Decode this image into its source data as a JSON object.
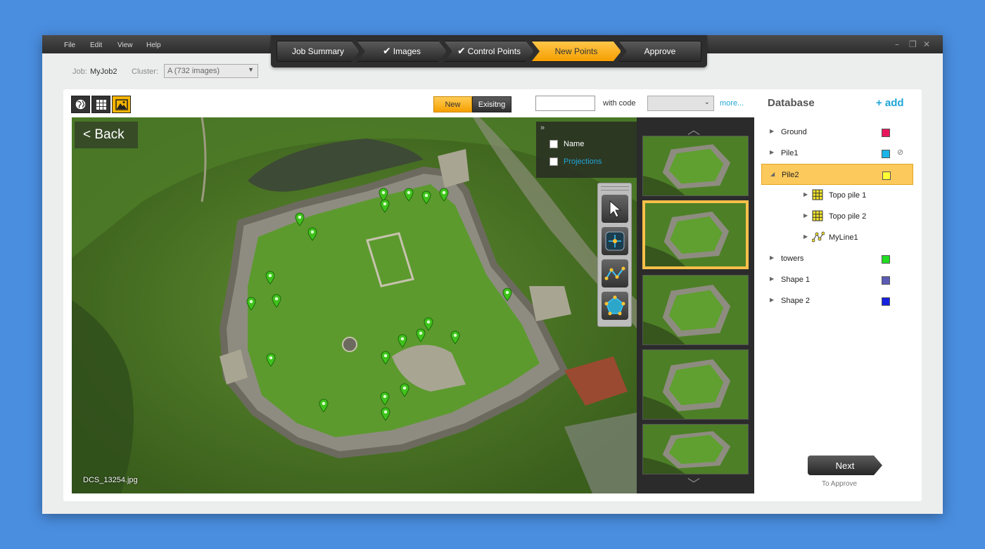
{
  "menu": [
    "File",
    "Edit",
    "View",
    "Help"
  ],
  "window_controls": [
    "–",
    "❐",
    "✕"
  ],
  "steps": [
    {
      "label": "Job Summary",
      "checked": false
    },
    {
      "label": "Images",
      "checked": true
    },
    {
      "label": "Control Points",
      "checked": true
    },
    {
      "label": "New Points",
      "active": true
    },
    {
      "label": "Approve"
    }
  ],
  "check_glyph": "✔",
  "job": {
    "label": "Job:",
    "value": "MyJob2"
  },
  "cluster": {
    "label": "Cluster:",
    "value": "A (732 images)"
  },
  "view_buttons": [
    "globe-icon",
    "grid-icon",
    "mountain-image-icon"
  ],
  "toggle": {
    "new": "New",
    "existing": "Exisitng"
  },
  "with_code": "with code",
  "more": "more...",
  "viewer": {
    "back": "< Back",
    "filename": "DCS_13254.jpg",
    "layers_expand": "»",
    "layers": [
      {
        "label": "Name",
        "color": "#ffffff"
      },
      {
        "label": "Projections",
        "color": "#1fa6d8"
      }
    ]
  },
  "thumb_arrows": {
    "up": "︿",
    "down": "﹀"
  },
  "database": {
    "title": "Database",
    "add": "+ add",
    "items": [
      {
        "name": "Ground",
        "color": "#e8175d",
        "level": 0,
        "expanded": false
      },
      {
        "name": "Pile1",
        "color": "#1bb4e6",
        "level": 0,
        "expanded": false,
        "hidden_icon": "👁"
      },
      {
        "name": "Pile2",
        "color": "#ffff33",
        "level": 0,
        "expanded": true,
        "selected": true
      },
      {
        "name": "Topo pile 1",
        "level": 1,
        "icon": "grid-points-icon"
      },
      {
        "name": "Topo pile 2",
        "level": 1,
        "icon": "grid-points-icon"
      },
      {
        "name": "MyLine1",
        "level": 1,
        "icon": "polyline-icon"
      },
      {
        "name": "towers",
        "color": "#22dd22",
        "level": 0,
        "expanded": false
      },
      {
        "name": "Shape 1",
        "color": "#5b5bb5",
        "level": 0,
        "expanded": false
      },
      {
        "name": "Shape 2",
        "color": "#1520e0",
        "level": 0,
        "expanded": false
      }
    ]
  },
  "next": {
    "label": "Next",
    "sub": "To Approve"
  }
}
